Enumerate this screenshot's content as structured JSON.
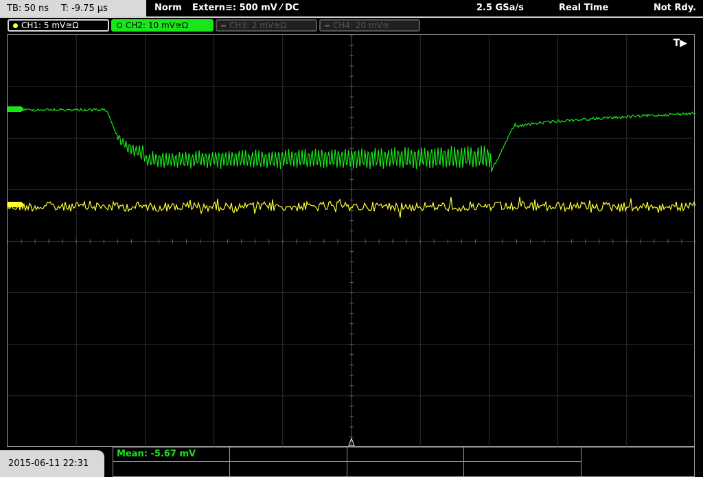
{
  "status": {
    "timebase": "TB: 50 ns",
    "trigger_time": "T: -9.75 µs",
    "mode": "Norm",
    "trigger_source": "Extern≅: 500 mV ⁄ DC",
    "sample_rate": "2.5 GSa/s",
    "acq_mode": "Real Time",
    "ready_state": "Not Rdy."
  },
  "channels": [
    {
      "label": "CH1: 5 mV≅Ω",
      "color": "#ffff33",
      "active": true
    },
    {
      "label": "CH2: 10 mV≅Ω",
      "color": "#19e619",
      "active": true,
      "selected": true
    },
    {
      "label": "CH3: 2 mV≅Ω",
      "color": "#555555",
      "active": false
    },
    {
      "label": "CH4: 20 mV≅",
      "color": "#555555",
      "active": false
    }
  ],
  "trigger_marker": "T▶",
  "measurement": {
    "label": "Mean: -5.67 mV",
    "color": "#19e619"
  },
  "datetime": "2015-06-11 22:31"
}
